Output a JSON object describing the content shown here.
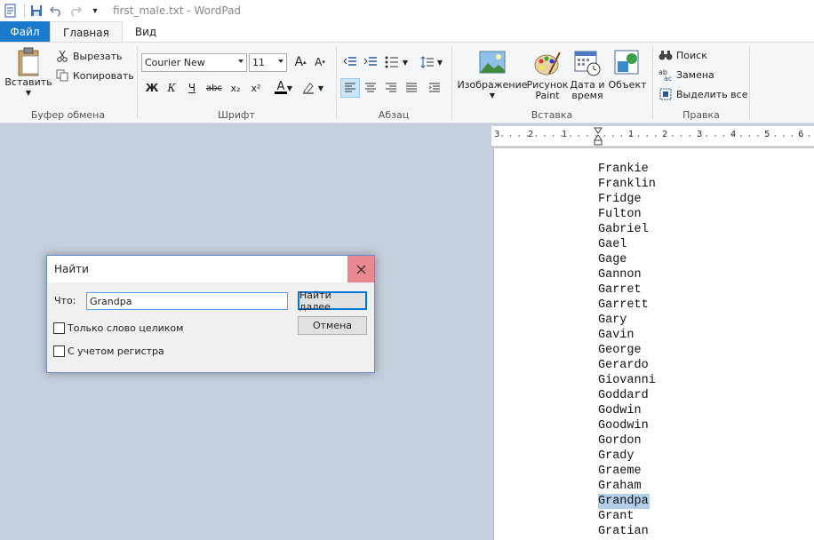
{
  "window": {
    "title": "first_male.txt - WordPad"
  },
  "quick_access": {
    "customize": "▾"
  },
  "tabs": [
    {
      "label": "Файл"
    },
    {
      "label": "Главная"
    },
    {
      "label": "Вид"
    }
  ],
  "ribbon": {
    "clipboard": {
      "label": "Буфер обмена",
      "paste": "Вставить",
      "cut": "Вырезать",
      "copy": "Копировать"
    },
    "font": {
      "label": "Шрифт",
      "family": "Courier New",
      "size": "11",
      "bold": "Ж",
      "italic": "К",
      "underline": "Ч",
      "strike": "abc",
      "subscript": "x₂",
      "superscript": "x²",
      "font_color": "A"
    },
    "paragraph": {
      "label": "Абзац"
    },
    "insert": {
      "label": "Вставка",
      "image": "Изображение",
      "paint": "Рисунок Paint",
      "paint_l1": "Рисунок",
      "paint_l2": "Paint",
      "datetime_l1": "Дата и",
      "datetime_l2": "время",
      "object": "Объект"
    },
    "editing": {
      "label": "Правка",
      "find": "Поиск",
      "replace": "Замена",
      "select_all": "Выделить все"
    }
  },
  "ruler": {
    "ticks": [
      "3",
      "2",
      "1",
      "1",
      "2",
      "3",
      "4",
      "5",
      "6"
    ]
  },
  "document": {
    "lines": [
      "Frankie",
      "Franklin",
      "Fridge",
      "Fulton",
      "Gabriel",
      "Gael",
      "Gage",
      "Gannon",
      "Garret",
      "Garrett",
      "Gary",
      "Gavin",
      "George",
      "Gerardo",
      "Giovanni",
      "Goddard",
      "Godwin",
      "Goodwin",
      "Gordon",
      "Grady",
      "Graeme",
      "Graham",
      "Grandpa",
      "Grant",
      "Gratian"
    ],
    "highlighted": "Grandpa"
  },
  "find_dialog": {
    "title": "Найти",
    "what_label": "Что:",
    "what_value": "Grandpa",
    "find_next": "Найти далее",
    "cancel": "Отмена",
    "whole_word": "Только слово целиком",
    "match_case": "С учетом регистра"
  }
}
